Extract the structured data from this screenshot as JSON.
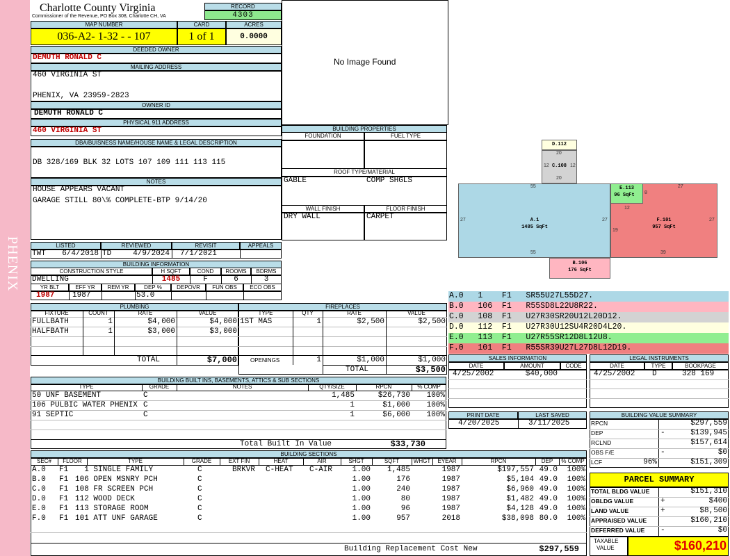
{
  "side_label": "PHENIX",
  "county": {
    "name": "Charlotte County Virginia",
    "sub": "Commissioner of the Revenue, PO Box 308, Charlotte CH, VA"
  },
  "record": {
    "label": "RECORD",
    "value": "4303"
  },
  "map": {
    "label": "MAP NUMBER",
    "value": "036-A2- 1-32 -  - 107"
  },
  "card": {
    "label": "CARD",
    "value": "1 of 1"
  },
  "acres": {
    "label": "ACRES",
    "value": "0.0000"
  },
  "owner": {
    "deeded_label": "DEEDED OWNER",
    "deeded": "DEMUTH RONALD  C",
    "mail_label": "MAILING ADDRESS",
    "mail1": "460 VIRGINIA ST",
    "mail2": "PHENIX, VA 23959-2823",
    "id_label": "OWNER ID",
    "id": "DEMUTH RONALD  C",
    "addr_label": "PHYSICAL 911 ADDRESS",
    "addr": "460 VIRGINIA ST"
  },
  "legal": {
    "label": "DBA/BUISNESS NAME/HOUSE NAME & LEGAL DESCRIPTION",
    "text": "DB 328/169 BLK 32 LOTS 107 109 111 113 115"
  },
  "notes": {
    "label": "NOTES",
    "line1": "HOUSE APPEARS VACANT",
    "line2": "GARAGE STILL 80\\% COMPLETE-BTP 9/14/20"
  },
  "image": {
    "text": "No Image Found"
  },
  "bprops": {
    "label": "BUILDING PROPERTIES",
    "foundation_label": "FOUNDATION",
    "fuel_label": "FUEL TYPE",
    "roof_label": "ROOF TYPE/MATERIAL",
    "roof1": "GABLE",
    "roof2": "COMP SHGLS",
    "wall_label": "WALL FINISH",
    "wall": "DRY WALL",
    "floor_label": "FLOOR FINISH",
    "floor": "CARPET"
  },
  "dates": {
    "listed_label": "LISTED",
    "listed_by": "TWT",
    "listed": "6/4/2018",
    "reviewed_label": "REVIEWED",
    "reviewed_by": "TD",
    "reviewed": "4/9/2024",
    "revisit_label": "REVISIT",
    "revisit": "7/1/2021",
    "appeals_label": "APPEALS"
  },
  "binfo": {
    "label": "BUILDING INFORMATION",
    "style_label": "CONSTRUCTION STYLE",
    "hsqft_label": "H SQFT",
    "cond_label": "COND",
    "rooms_label": "ROOMS",
    "bdrms_label": "BDRMS",
    "style": "DWELLING",
    "hsqft": "1485",
    "cond": "F",
    "rooms": "6",
    "bdrms": "3",
    "yrblt_label": "YR BLT",
    "effyr_label": "EFF YR",
    "remyr_label": "REM YR",
    "dep_label": "DEP %",
    "depovr_label": "DEPOVR",
    "funobs_label": "FUN OBS",
    "ecoobs_label": "ECO OBS",
    "yrblt": "1987",
    "effyr": "1987",
    "dep": "53.0"
  },
  "plumbing": {
    "label": "PLUMBING",
    "headers": [
      "FIXTURE",
      "COUNT",
      "RATE",
      "VALUE"
    ],
    "rows": [
      [
        "FULLBATH",
        "1",
        "$4,000",
        "$4,000"
      ],
      [
        "HALFBATH",
        "1",
        "$3,000",
        "$3,000"
      ]
    ],
    "total_label": "TOTAL",
    "total": "$7,000"
  },
  "fireplaces": {
    "label": "FIREPLACES",
    "headers": [
      "TYPE",
      "QTY",
      "RATE",
      "VALUE"
    ],
    "rows": [
      [
        "1ST MAS",
        "1",
        "$2,500",
        "$2,500"
      ]
    ],
    "openings_label": "OPENINGS",
    "openings": [
      "1",
      "$1,000",
      "$1,000"
    ],
    "total_label": "TOTAL",
    "total": "$3,500"
  },
  "sketch": {
    "D112": "D.112",
    "D112w": "20",
    "C108": "C.108",
    "C108l": "12",
    "C108r": "12",
    "C108b": "20",
    "A1": "A.1",
    "A1s": "1485 SqFt",
    "A1t": "55",
    "A1b": "55",
    "A1l": "27",
    "A1r": "27",
    "E113": "E.113",
    "E113s": "96 SqFt",
    "E113r": "8",
    "E113b": "12",
    "F101": "F.101",
    "F101s": "957 SqFt",
    "F101t": "27",
    "F101r": "27",
    "F101l": "19",
    "F101b": "39",
    "B106": "B.106",
    "B106s": "176 SqFt"
  },
  "vectors": [
    {
      "text": "A.0   1    F1   SR55U27L55D27.",
      "color": "#add8e6"
    },
    {
      "text": "B.0   106  F1   R55SD8L22U8R22.",
      "color": "#ffb6c1"
    },
    {
      "text": "C.0   108  F1   U27R30SR20U12L20D12.",
      "color": "#d3d3d3"
    },
    {
      "text": "D.0   112  F1   U27R30U12SU4R20D4L20.",
      "color": "#ffffe0"
    },
    {
      "text": "E.0   113  F1   U27R55SR12D8L12U8.",
      "color": "#90ee90"
    },
    {
      "text": "F.0   101  F1   R55SR39U27L27D8L12D19.",
      "color": "#f08080"
    }
  ],
  "sales": {
    "label": "SALES INFORMATION",
    "headers": [
      "DATE",
      "AMOUNT",
      "CODE"
    ],
    "row": [
      "4/25/2002",
      "$40,000",
      ""
    ]
  },
  "legalinst": {
    "label": "LEGAL INSTRUMENTS",
    "headers": [
      "DATE",
      "TYPE",
      "BOOKPAGE"
    ],
    "row": [
      "4/25/2002",
      "D",
      "328 169"
    ]
  },
  "builtins": {
    "label": "BUILDING BUILT INS, BASEMENTS, ATTICS & SUB SECTIONS",
    "headers": [
      "TYPE",
      "GRADE",
      "NOTES",
      "QTY/SIZE",
      "RPCN",
      "% COMP"
    ],
    "rows": [
      [
        "50 UNF BASEMENT",
        "C",
        "",
        "1,485",
        "$26,730",
        "100%"
      ],
      [
        "106 PULBIC WATER PHENIX",
        "C",
        "",
        "1",
        "$1,000",
        "100%"
      ],
      [
        "91 SEPTIC",
        "C",
        "",
        "1",
        "$6,000",
        "100%"
      ]
    ],
    "total_label": "Total Built In Value",
    "total": "$33,730"
  },
  "print": {
    "print_label": "PRINT DATE",
    "print": "4/20/2025",
    "saved_label": "LAST SAVED",
    "saved": "3/11/2025"
  },
  "bvs": {
    "label": "BUILDING VALUE SUMMARY",
    "rows": [
      {
        "k": "RPCN",
        "s": "",
        "v": "$297,559"
      },
      {
        "k": "DEP",
        "s": "-",
        "v": "$139,945"
      },
      {
        "k": "RCLND",
        "s": "",
        "v": "$157,614"
      },
      {
        "k": "OBS F/E",
        "s": "-",
        "v": "$0"
      },
      {
        "k": "LCF",
        "p": "96%",
        "s": "",
        "v": "$151,309"
      }
    ]
  },
  "sections": {
    "label": "BUILDING SECTIONS",
    "headers": [
      "SEC#",
      "FLOOR",
      "TYPE",
      "GRADE",
      "EXT FIN",
      "HEAT",
      "AIR",
      "SHGT",
      "SQFT",
      "WHGT",
      "EYEAR",
      "RPCN",
      "DEP",
      "% COMP"
    ],
    "rows": [
      [
        "A.0",
        "F1",
        "1 SINGLE FAMILY",
        "C",
        "BRKVR",
        "C-HEAT",
        "C-AIR",
        "1.00",
        "1,485",
        "",
        "1987",
        "$197,557",
        "49.0",
        "100%"
      ],
      [
        "B.0",
        "F1",
        "106 OPEN MSNRY PCH",
        "C",
        "",
        "",
        "",
        "1.00",
        "176",
        "",
        "1987",
        "$5,104",
        "49.0",
        "100%"
      ],
      [
        "C.0",
        "F1",
        "108 FR SCREEN PCH",
        "C",
        "",
        "",
        "",
        "1.00",
        "240",
        "",
        "1987",
        "$6,960",
        "49.0",
        "100%"
      ],
      [
        "D.0",
        "F1",
        "112 WOOD DECK",
        "C",
        "",
        "",
        "",
        "1.00",
        "80",
        "",
        "1987",
        "$1,482",
        "49.0",
        "100%"
      ],
      [
        "E.0",
        "F1",
        "113 STORAGE ROOM",
        "C",
        "",
        "",
        "",
        "1.00",
        "96",
        "",
        "1987",
        "$4,128",
        "49.0",
        "100%"
      ],
      [
        "F.0",
        "F1",
        "101 ATT UNF GARAGE",
        "C",
        "",
        "",
        "",
        "1.00",
        "957",
        "",
        "2018",
        "$38,098",
        "80.0",
        "100%"
      ]
    ],
    "brcn_label": "Building Replacement Cost New",
    "brcn": "$297,559"
  },
  "parcel": {
    "label": "PARCEL SUMMARY",
    "rows": [
      {
        "k": "TOTAL BLDG VALUE",
        "s": "",
        "v": "$151,310"
      },
      {
        "k": "OBLDG VALUE",
        "s": "+",
        "v": "$400"
      },
      {
        "k": "LAND VALUE",
        "s": "+",
        "v": "$8,500"
      },
      {
        "k": "APPRAISED VALUE",
        "s": "",
        "v": "$160,210"
      },
      {
        "k": "DEFERRED VALUE",
        "s": "-",
        "v": "$0"
      }
    ],
    "taxable_label1": "TAXABLE",
    "taxable_label2": "VALUE",
    "taxable": "$160,210"
  }
}
